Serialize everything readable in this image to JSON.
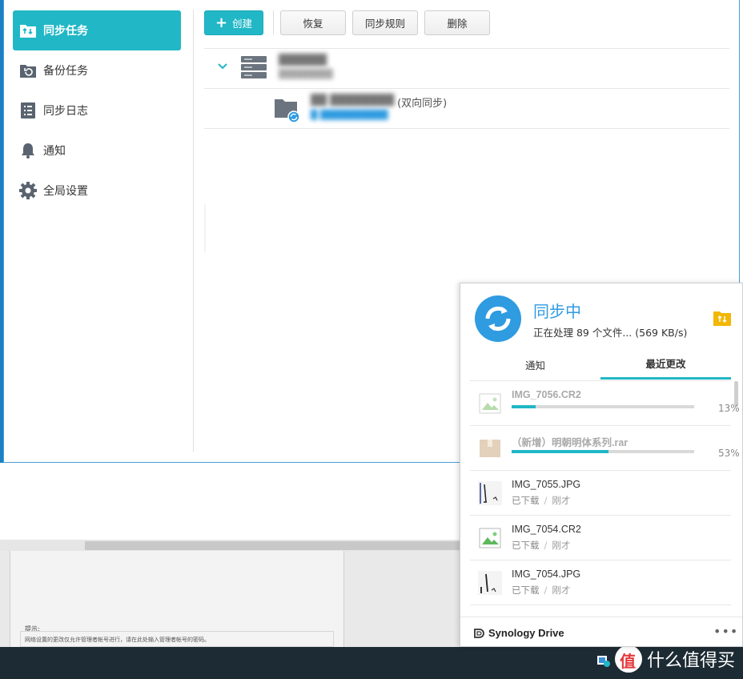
{
  "sidebar": {
    "items": [
      {
        "label": "同步任务",
        "icon": "sync-folder-icon",
        "active": true
      },
      {
        "label": "备份任务",
        "icon": "backup-icon",
        "active": false
      },
      {
        "label": "同步日志",
        "icon": "log-icon",
        "active": false
      },
      {
        "label": "通知",
        "icon": "bell-icon",
        "active": false
      },
      {
        "label": "全局设置",
        "icon": "gear-icon",
        "active": false
      }
    ]
  },
  "toolbar": {
    "create_label": "创建",
    "restore_label": "恢复",
    "rules_label": "同步规则",
    "delete_label": "删除"
  },
  "task_list": {
    "task": {
      "mode": "(双向同步)"
    }
  },
  "panel": {
    "status_title": "同步中",
    "status_detail": "正在处理 89 个文件... (569 KB/s)",
    "tabs": [
      "通知",
      "最近更改"
    ],
    "active_tab": 1,
    "files": [
      {
        "name": "IMG_7056.CR2",
        "progress": 0.13,
        "percent": "13%",
        "thumb": "image-thumb-icon"
      },
      {
        "name": "（新增）明朝明体系列.rar",
        "progress": 0.53,
        "percent": "53%",
        "thumb": "archive-icon"
      },
      {
        "name": "IMG_7055.JPG",
        "status": "已下载",
        "when": "刚才",
        "thumb": "photo-thumb"
      },
      {
        "name": "IMG_7054.CR2",
        "status": "已下载",
        "when": "刚才",
        "thumb": "image-thumb-icon"
      },
      {
        "name": "IMG_7054.JPG",
        "status": "已下载",
        "when": "刚才",
        "thumb": "photo-thumb"
      }
    ],
    "footer_brand": "Synology Drive",
    "more_label": "•••"
  },
  "background": {
    "hint_title": "提示:",
    "hint_text": "网络设置的更改仅允许管理者帐号进行，请在此处输入管理者帐号的密码。"
  },
  "watermark": {
    "text": "什么值得买"
  },
  "colors": {
    "accent": "#21b7c6",
    "link": "#2f9be0",
    "progress_track": "#d9d9d9"
  }
}
